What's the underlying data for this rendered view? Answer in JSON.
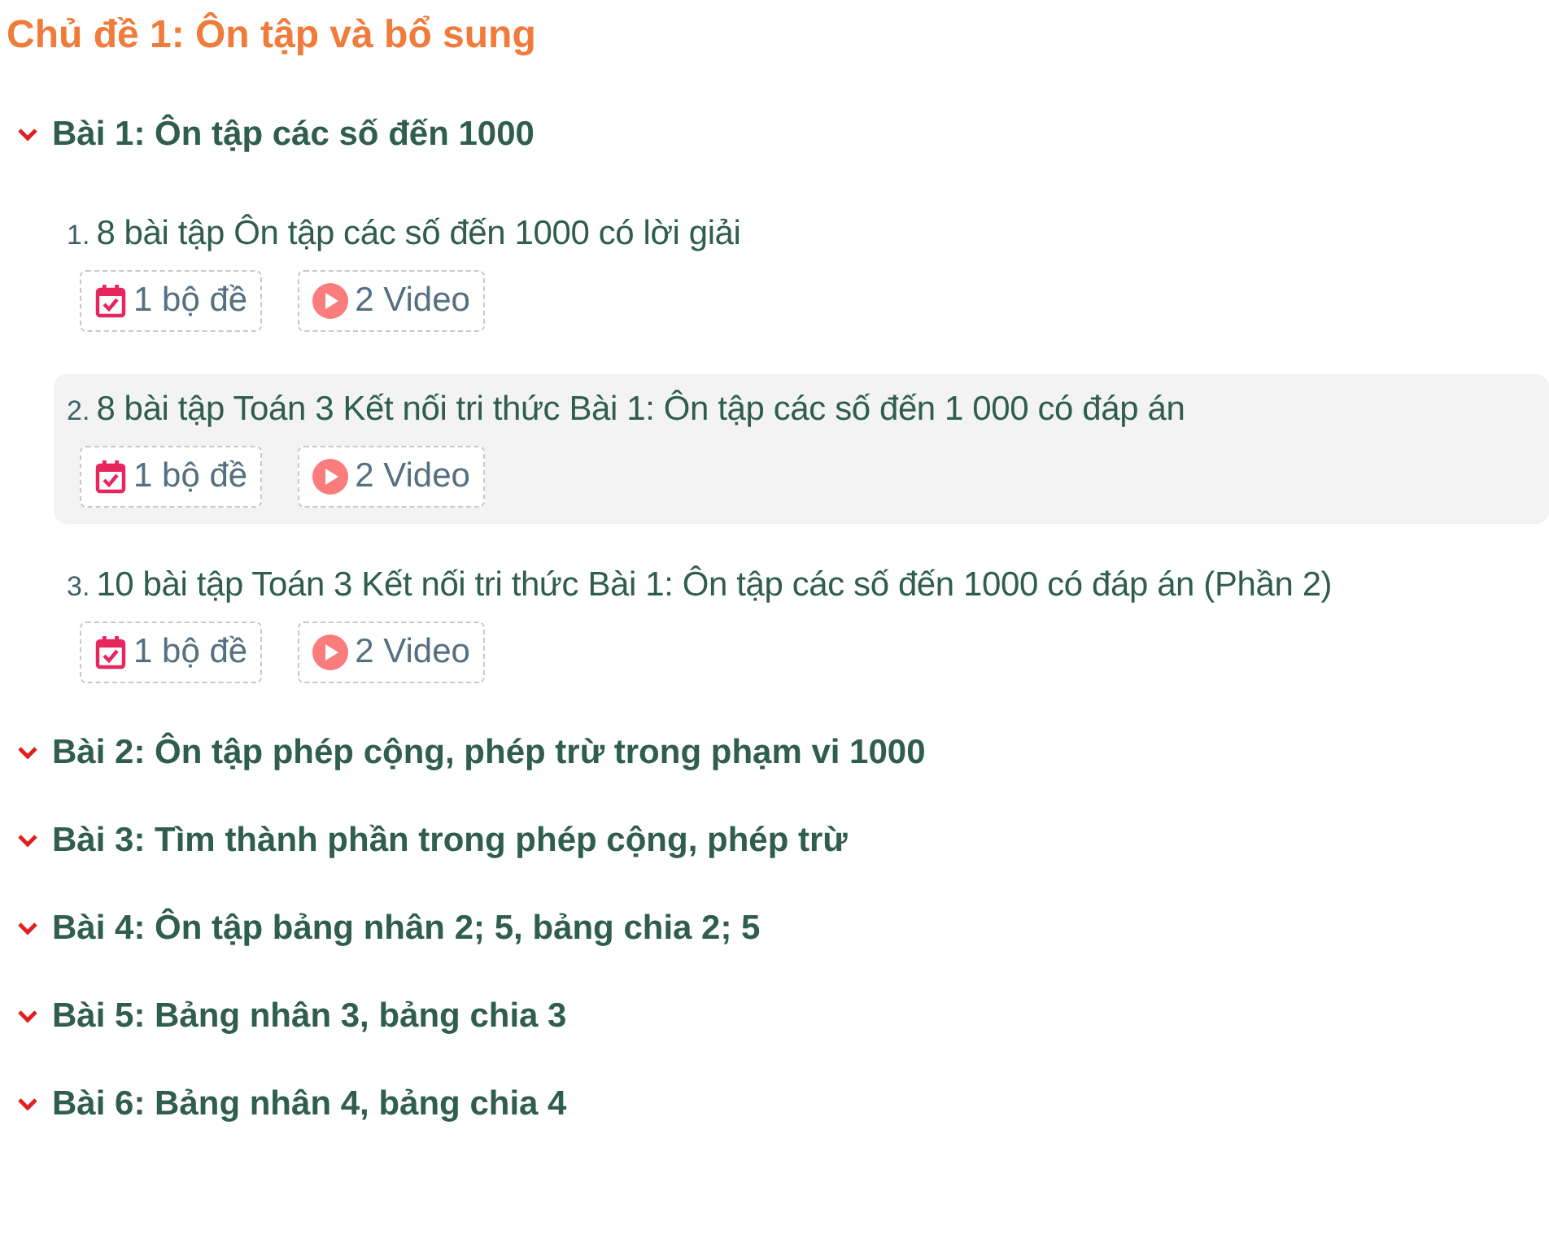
{
  "topic": {
    "title": "Chủ đề 1: Ôn tập và bổ sung"
  },
  "lessons": [
    {
      "title": "Bài 1: Ôn tập các số đến 1000",
      "items": [
        {
          "number": "1.",
          "title": "8 bài tập Ôn tập các số đến 1000 có lời giải",
          "selected": false,
          "badges": [
            {
              "kind": "test",
              "label": "1 bộ đề"
            },
            {
              "kind": "video",
              "label": "2 Video"
            }
          ]
        },
        {
          "number": "2.",
          "title": "8 bài tập Toán 3 Kết nối tri thức Bài 1: Ôn tập các số đến 1 000 có đáp án",
          "selected": true,
          "badges": [
            {
              "kind": "test",
              "label": "1 bộ đề"
            },
            {
              "kind": "video",
              "label": "2 Video"
            }
          ]
        },
        {
          "number": "3.",
          "title": "10 bài tập Toán 3 Kết nối tri thức Bài 1: Ôn tập các số đến 1000 có đáp án (Phần 2)",
          "selected": false,
          "badges": [
            {
              "kind": "test",
              "label": "1 bộ đề"
            },
            {
              "kind": "video",
              "label": "2 Video"
            }
          ]
        }
      ]
    },
    {
      "title": "Bài 2: Ôn tập phép cộng, phép trừ trong phạm vi 1000"
    },
    {
      "title": "Bài 3: Tìm thành phần trong phép cộng, phép trừ"
    },
    {
      "title": "Bài 4: Ôn tập bảng nhân 2; 5, bảng chia 2; 5"
    },
    {
      "title": "Bài 5: Bảng nhân 3, bảng chia 3"
    },
    {
      "title": "Bài 6: Bảng nhân 4, bảng chia 4"
    }
  ]
}
